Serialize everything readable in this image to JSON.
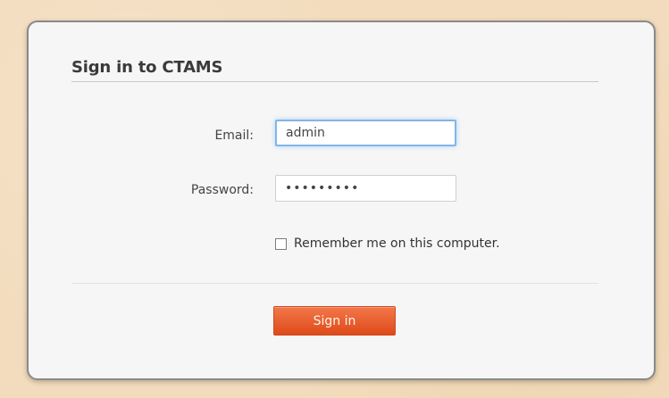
{
  "card": {
    "title": "Sign in to CTAMS"
  },
  "form": {
    "email_label": "Email:",
    "email_value": "admin",
    "password_label": "Password:",
    "password_value": "•••••••••",
    "remember_label": "Remember me on this computer.",
    "remember_checked": false,
    "submit_label": "Sign in"
  },
  "colors": {
    "background": "#f3dcbd",
    "card": "#f6f6f6",
    "card_border": "#8a8a8a",
    "accent": "#ef6a3a",
    "focus": "#7fb6ea"
  }
}
